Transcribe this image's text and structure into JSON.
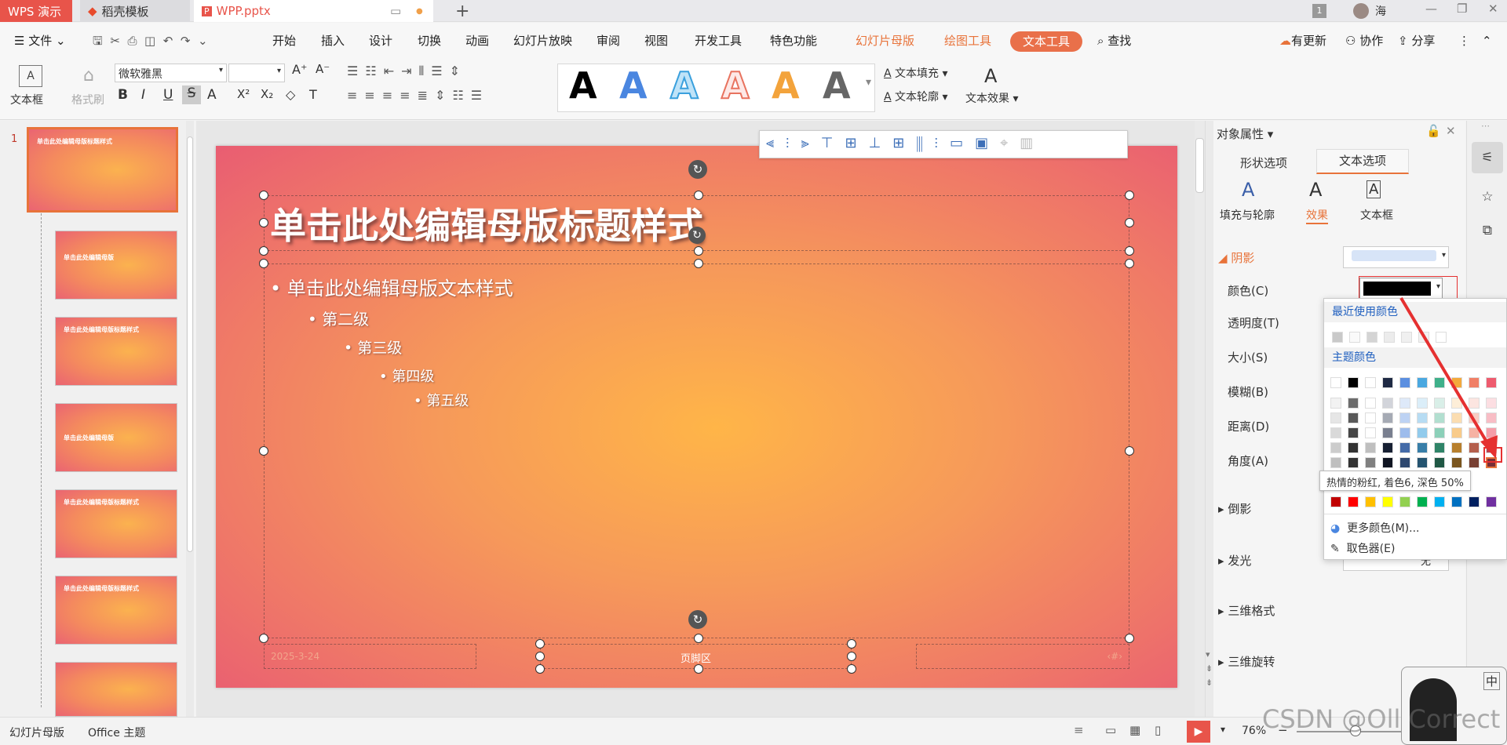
{
  "titlebar": {
    "app_tab": "WPS 演示",
    "tab2": "稻壳模板",
    "doc_tab": "WPP.pptx",
    "page_badge": "1",
    "user_name": "海"
  },
  "menu": {
    "file": "文件",
    "items": [
      "开始",
      "插入",
      "设计",
      "切换",
      "动画",
      "幻灯片放映",
      "审阅",
      "视图",
      "开发工具",
      "特色功能"
    ],
    "master": "幻灯片母版",
    "drawing": "绘图工具",
    "text_tool": "文本工具",
    "search": "查找",
    "update": "有更新",
    "collab": "协作",
    "share": "分享"
  },
  "ribbon": {
    "textbox": "文本框",
    "format_brush": "格式刷",
    "font_name": "微软雅黑",
    "font_size": "",
    "text_fill": "文本填充",
    "text_outline": "文本轮廓",
    "text_effect": "文本效果",
    "sample_letter": "A"
  },
  "thumbnails": {
    "first_num": "1",
    "title": "单击此处编辑母版标题样式",
    "title_short": "单击此处编辑母版"
  },
  "slide": {
    "title": "单击此处编辑母版标题样式",
    "levels": [
      "单击此处编辑母版文本样式",
      "第二级",
      "第三级",
      "第四级",
      "第五级"
    ],
    "date": "2025-3-24",
    "footer": "页脚区",
    "number": "‹#›"
  },
  "panel": {
    "title": "对象属性",
    "tab_shape": "形状选项",
    "tab_text": "文本选项",
    "sub_fill": "填充与轮廓",
    "sub_effect": "效果",
    "sub_textbox": "文本框",
    "shadow": "阴影",
    "color": "颜色(C)",
    "transparency": "透明度(T)",
    "size": "大小(S)",
    "blur": "模糊(B)",
    "distance": "距离(D)",
    "angle": "角度(A)",
    "reflection": "倒影",
    "glow": "发光",
    "format3d": "三维格式",
    "rotate3d": "三维旋转",
    "glow_value": "无"
  },
  "colorpicker": {
    "recent": "最近使用颜色",
    "theme": "主题颜色",
    "tooltip": "热情的粉红, 着色6, 深色 50%",
    "more": "更多颜色(M)...",
    "picker": "取色器(E)",
    "theme_top": [
      "#ffffff",
      "#000000",
      "#ffffff",
      "#1f2a44",
      "#5b8fe0",
      "#4aa8e0",
      "#3fb08a",
      "#f4a93c",
      "#f07f66",
      "#ee5b6e"
    ],
    "standard": [
      "#c00000",
      "#ff0000",
      "#ffc000",
      "#ffff00",
      "#92d050",
      "#00b050",
      "#00b0f0",
      "#0070c0",
      "#002060",
      "#7030a0"
    ]
  },
  "statusbar": {
    "mode": "幻灯片母版",
    "theme": "Office 主题",
    "zoom": "76%"
  },
  "watermark": "CSDN @Oll Correct"
}
